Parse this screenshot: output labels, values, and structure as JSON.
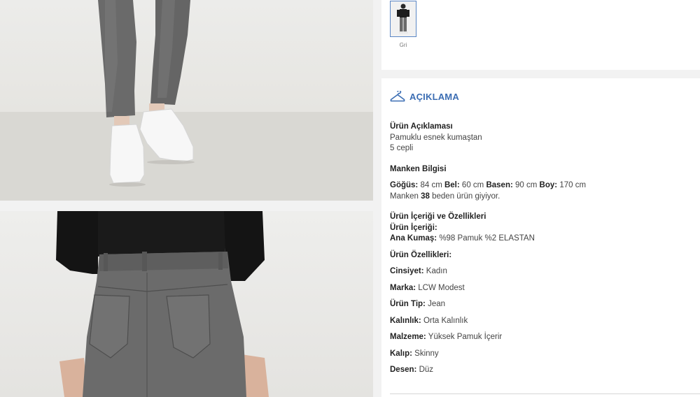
{
  "gallery": {
    "images": [
      {
        "name": "product-photo-lower-legs"
      },
      {
        "name": "product-photo-back-view"
      }
    ]
  },
  "variant": {
    "color_label": "Gri",
    "selected": true
  },
  "description": {
    "section_title": "AÇIKLAMA",
    "product_desc": {
      "heading": "Ürün Açıklaması",
      "lines": [
        "Pamuklu esnek kumaştan",
        "5 cepli"
      ]
    },
    "model_info": {
      "heading": "Manken Bilgisi",
      "measurements": [
        {
          "label": "Göğüs:",
          "value": "84 cm"
        },
        {
          "label": "Bel:",
          "value": "60 cm"
        },
        {
          "label": "Basen:",
          "value": "90 cm"
        },
        {
          "label": "Boy:",
          "value": "170 cm"
        }
      ],
      "size_prefix": "Manken",
      "size_value": "38",
      "size_suffix": "beden ürün giyiyor."
    },
    "contents": {
      "heading": "Ürün İçeriği ve Özellikleri",
      "sub_heading": "Ürün İçeriği:",
      "fabric_label": "Ana Kumaş:",
      "fabric_value": "%98 Pamuk %2 ELASTAN",
      "features_heading": "Ürün Özellikleri:",
      "features": [
        {
          "label": "Cinsiyet:",
          "value": "Kadın"
        },
        {
          "label": "Marka:",
          "value": "LCW Modest"
        },
        {
          "label": "Ürün Tip:",
          "value": "Jean"
        },
        {
          "label": "Kalınlık:",
          "value": "Orta Kalınlık"
        },
        {
          "label": "Malzeme:",
          "value": "Yüksek Pamuk İçerir"
        },
        {
          "label": "Kalıp:",
          "value": "Skinny"
        },
        {
          "label": "Desen:",
          "value": "Düz"
        }
      ]
    }
  },
  "colors": {
    "accent": "#3b6db3",
    "denim": "#5e5e5e",
    "background": "#f2f2f2"
  }
}
